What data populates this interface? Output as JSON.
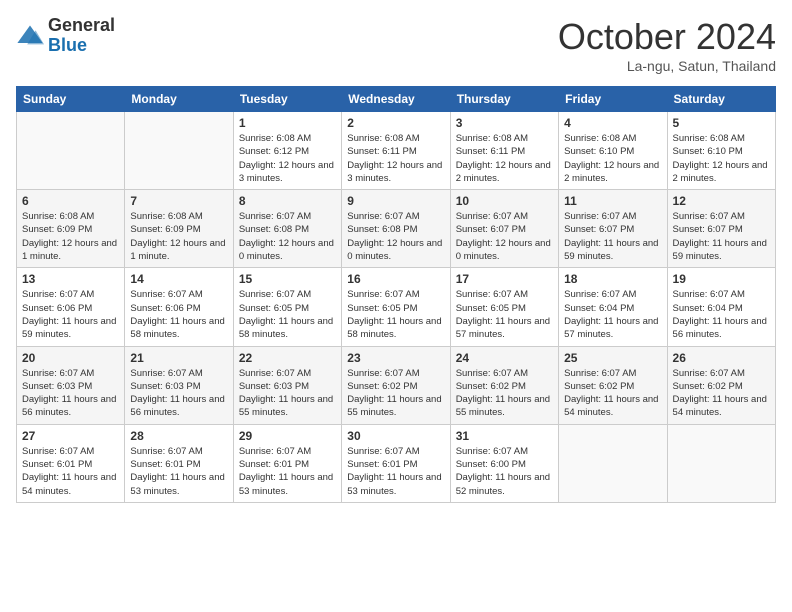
{
  "header": {
    "logo": {
      "general": "General",
      "blue": "Blue"
    },
    "title": "October 2024",
    "subtitle": "La-ngu, Satun, Thailand"
  },
  "weekdays": [
    "Sunday",
    "Monday",
    "Tuesday",
    "Wednesday",
    "Thursday",
    "Friday",
    "Saturday"
  ],
  "weeks": [
    [
      {
        "day": null
      },
      {
        "day": null
      },
      {
        "day": 1,
        "sunrise": "Sunrise: 6:08 AM",
        "sunset": "Sunset: 6:12 PM",
        "daylight": "Daylight: 12 hours and 3 minutes."
      },
      {
        "day": 2,
        "sunrise": "Sunrise: 6:08 AM",
        "sunset": "Sunset: 6:11 PM",
        "daylight": "Daylight: 12 hours and 3 minutes."
      },
      {
        "day": 3,
        "sunrise": "Sunrise: 6:08 AM",
        "sunset": "Sunset: 6:11 PM",
        "daylight": "Daylight: 12 hours and 2 minutes."
      },
      {
        "day": 4,
        "sunrise": "Sunrise: 6:08 AM",
        "sunset": "Sunset: 6:10 PM",
        "daylight": "Daylight: 12 hours and 2 minutes."
      },
      {
        "day": 5,
        "sunrise": "Sunrise: 6:08 AM",
        "sunset": "Sunset: 6:10 PM",
        "daylight": "Daylight: 12 hours and 2 minutes."
      }
    ],
    [
      {
        "day": 6,
        "sunrise": "Sunrise: 6:08 AM",
        "sunset": "Sunset: 6:09 PM",
        "daylight": "Daylight: 12 hours and 1 minute."
      },
      {
        "day": 7,
        "sunrise": "Sunrise: 6:08 AM",
        "sunset": "Sunset: 6:09 PM",
        "daylight": "Daylight: 12 hours and 1 minute."
      },
      {
        "day": 8,
        "sunrise": "Sunrise: 6:07 AM",
        "sunset": "Sunset: 6:08 PM",
        "daylight": "Daylight: 12 hours and 0 minutes."
      },
      {
        "day": 9,
        "sunrise": "Sunrise: 6:07 AM",
        "sunset": "Sunset: 6:08 PM",
        "daylight": "Daylight: 12 hours and 0 minutes."
      },
      {
        "day": 10,
        "sunrise": "Sunrise: 6:07 AM",
        "sunset": "Sunset: 6:07 PM",
        "daylight": "Daylight: 12 hours and 0 minutes."
      },
      {
        "day": 11,
        "sunrise": "Sunrise: 6:07 AM",
        "sunset": "Sunset: 6:07 PM",
        "daylight": "Daylight: 11 hours and 59 minutes."
      },
      {
        "day": 12,
        "sunrise": "Sunrise: 6:07 AM",
        "sunset": "Sunset: 6:07 PM",
        "daylight": "Daylight: 11 hours and 59 minutes."
      }
    ],
    [
      {
        "day": 13,
        "sunrise": "Sunrise: 6:07 AM",
        "sunset": "Sunset: 6:06 PM",
        "daylight": "Daylight: 11 hours and 59 minutes."
      },
      {
        "day": 14,
        "sunrise": "Sunrise: 6:07 AM",
        "sunset": "Sunset: 6:06 PM",
        "daylight": "Daylight: 11 hours and 58 minutes."
      },
      {
        "day": 15,
        "sunrise": "Sunrise: 6:07 AM",
        "sunset": "Sunset: 6:05 PM",
        "daylight": "Daylight: 11 hours and 58 minutes."
      },
      {
        "day": 16,
        "sunrise": "Sunrise: 6:07 AM",
        "sunset": "Sunset: 6:05 PM",
        "daylight": "Daylight: 11 hours and 58 minutes."
      },
      {
        "day": 17,
        "sunrise": "Sunrise: 6:07 AM",
        "sunset": "Sunset: 6:05 PM",
        "daylight": "Daylight: 11 hours and 57 minutes."
      },
      {
        "day": 18,
        "sunrise": "Sunrise: 6:07 AM",
        "sunset": "Sunset: 6:04 PM",
        "daylight": "Daylight: 11 hours and 57 minutes."
      },
      {
        "day": 19,
        "sunrise": "Sunrise: 6:07 AM",
        "sunset": "Sunset: 6:04 PM",
        "daylight": "Daylight: 11 hours and 56 minutes."
      }
    ],
    [
      {
        "day": 20,
        "sunrise": "Sunrise: 6:07 AM",
        "sunset": "Sunset: 6:03 PM",
        "daylight": "Daylight: 11 hours and 56 minutes."
      },
      {
        "day": 21,
        "sunrise": "Sunrise: 6:07 AM",
        "sunset": "Sunset: 6:03 PM",
        "daylight": "Daylight: 11 hours and 56 minutes."
      },
      {
        "day": 22,
        "sunrise": "Sunrise: 6:07 AM",
        "sunset": "Sunset: 6:03 PM",
        "daylight": "Daylight: 11 hours and 55 minutes."
      },
      {
        "day": 23,
        "sunrise": "Sunrise: 6:07 AM",
        "sunset": "Sunset: 6:02 PM",
        "daylight": "Daylight: 11 hours and 55 minutes."
      },
      {
        "day": 24,
        "sunrise": "Sunrise: 6:07 AM",
        "sunset": "Sunset: 6:02 PM",
        "daylight": "Daylight: 11 hours and 55 minutes."
      },
      {
        "day": 25,
        "sunrise": "Sunrise: 6:07 AM",
        "sunset": "Sunset: 6:02 PM",
        "daylight": "Daylight: 11 hours and 54 minutes."
      },
      {
        "day": 26,
        "sunrise": "Sunrise: 6:07 AM",
        "sunset": "Sunset: 6:02 PM",
        "daylight": "Daylight: 11 hours and 54 minutes."
      }
    ],
    [
      {
        "day": 27,
        "sunrise": "Sunrise: 6:07 AM",
        "sunset": "Sunset: 6:01 PM",
        "daylight": "Daylight: 11 hours and 54 minutes."
      },
      {
        "day": 28,
        "sunrise": "Sunrise: 6:07 AM",
        "sunset": "Sunset: 6:01 PM",
        "daylight": "Daylight: 11 hours and 53 minutes."
      },
      {
        "day": 29,
        "sunrise": "Sunrise: 6:07 AM",
        "sunset": "Sunset: 6:01 PM",
        "daylight": "Daylight: 11 hours and 53 minutes."
      },
      {
        "day": 30,
        "sunrise": "Sunrise: 6:07 AM",
        "sunset": "Sunset: 6:01 PM",
        "daylight": "Daylight: 11 hours and 53 minutes."
      },
      {
        "day": 31,
        "sunrise": "Sunrise: 6:07 AM",
        "sunset": "Sunset: 6:00 PM",
        "daylight": "Daylight: 11 hours and 52 minutes."
      },
      {
        "day": null
      },
      {
        "day": null
      }
    ]
  ]
}
